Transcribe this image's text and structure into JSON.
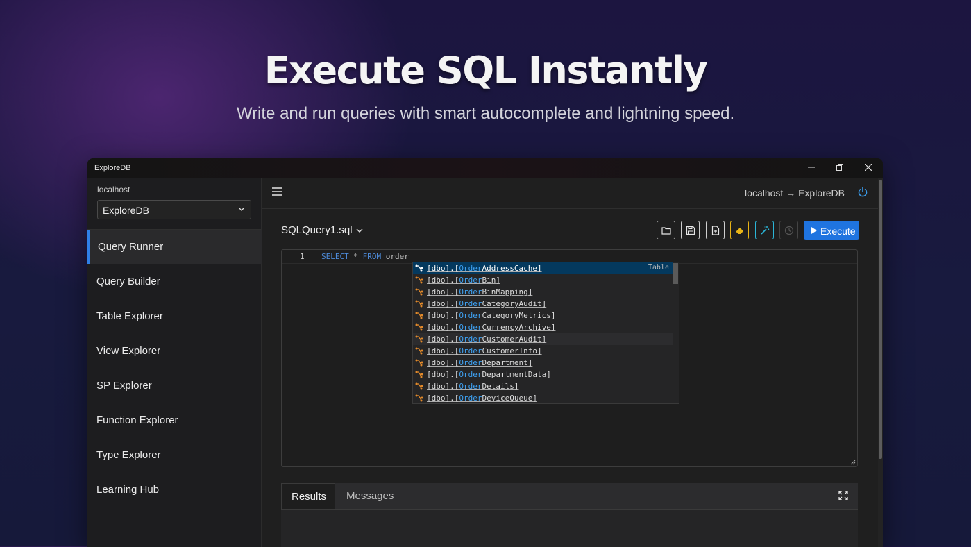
{
  "hero": {
    "title": "Execute SQL Instantly",
    "subtitle": "Write and run queries with smart autocomplete and lightning speed."
  },
  "window": {
    "title": "ExploreDB",
    "controls": [
      "minimize-icon",
      "restore-icon",
      "close-icon"
    ]
  },
  "sidebar": {
    "host": "localhost",
    "database": "ExploreDB",
    "items": [
      {
        "label": "Query Runner",
        "active": true
      },
      {
        "label": "Query Builder"
      },
      {
        "label": "Table Explorer"
      },
      {
        "label": "View Explorer"
      },
      {
        "label": "SP Explorer"
      },
      {
        "label": "Function Explorer"
      },
      {
        "label": "Type Explorer"
      },
      {
        "label": "Learning Hub"
      }
    ]
  },
  "topbar": {
    "connection": "localhost → ExploreDB"
  },
  "toolbar": {
    "file_name": "SQLQuery1.sql",
    "buttons": [
      "open-folder-icon",
      "save-icon",
      "new-file-icon",
      "eraser-icon",
      "magic-wand-icon",
      "history-icon"
    ],
    "execute_label": "Execute"
  },
  "editor": {
    "line_number": "1",
    "code": {
      "kw1": "SELECT",
      "op": "*",
      "kw2": "FROM",
      "ident": "order"
    }
  },
  "autocomplete": {
    "match": "Order",
    "selected_kind": "Table",
    "items": [
      {
        "prefix": "[dbo].[",
        "match": "Order",
        "rest": "AddressCache]"
      },
      {
        "prefix": "[dbo].[",
        "match": "Order",
        "rest": "Bin]"
      },
      {
        "prefix": "[dbo].[",
        "match": "Order",
        "rest": "BinMapping]"
      },
      {
        "prefix": "[dbo].[",
        "match": "Order",
        "rest": "CategoryAudit]"
      },
      {
        "prefix": "[dbo].[",
        "match": "Order",
        "rest": "CategoryMetrics]"
      },
      {
        "prefix": "[dbo].[",
        "match": "Order",
        "rest": "CurrencyArchive]"
      },
      {
        "prefix": "[dbo].[",
        "match": "Order",
        "rest": "CustomerAudit]"
      },
      {
        "prefix": "[dbo].[",
        "match": "Order",
        "rest": "CustomerInfo]"
      },
      {
        "prefix": "[dbo].[",
        "match": "Order",
        "rest": "Department]"
      },
      {
        "prefix": "[dbo].[",
        "match": "Order",
        "rest": "DepartmentData]"
      },
      {
        "prefix": "[dbo].[",
        "match": "Order",
        "rest": "Details]"
      },
      {
        "prefix": "[dbo].[",
        "match": "Order",
        "rest": "DeviceQueue]"
      }
    ]
  },
  "results": {
    "tabs": [
      {
        "label": "Results",
        "active": true
      },
      {
        "label": "Messages"
      }
    ]
  },
  "colors": {
    "accent": "#1f74e0",
    "active_indicator": "#2f7fe8",
    "match_highlight": "#3ea1f2",
    "eraser": "#e8b417",
    "magic_wand": "#2bb6d8",
    "table_icon": "#e38a2a"
  }
}
